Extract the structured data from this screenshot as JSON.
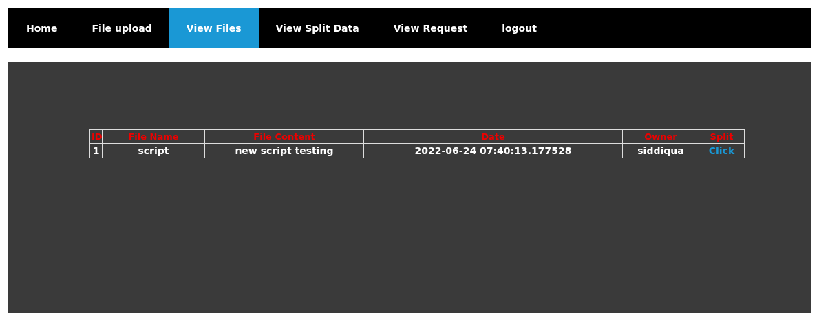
{
  "nav": [
    {
      "label": "Home",
      "selected": false
    },
    {
      "label": "File upload",
      "selected": false
    },
    {
      "label": "View Files",
      "selected": true
    },
    {
      "label": "View Split Data",
      "selected": false
    },
    {
      "label": "View Request",
      "selected": false
    },
    {
      "label": "logout",
      "selected": false
    }
  ],
  "table": {
    "columns": [
      "ID",
      "File Name",
      "File Content",
      "Date",
      "Owner",
      "Split"
    ],
    "rows": [
      {
        "cells": [
          "1",
          "script",
          "new script testing",
          "2022-06-24 07:40:13.177528",
          "siddiqua"
        ],
        "link": "Click"
      }
    ]
  }
}
